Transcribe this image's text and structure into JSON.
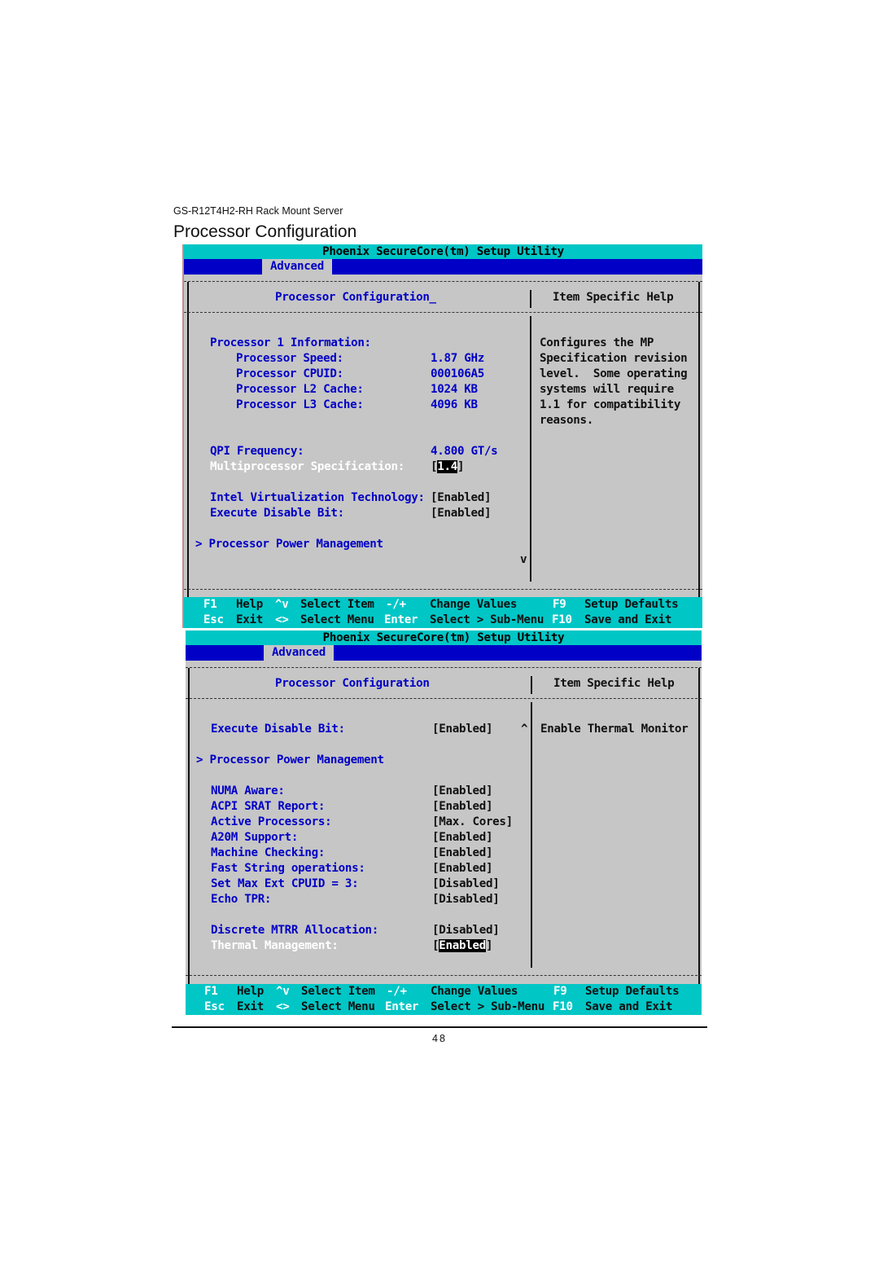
{
  "document": {
    "header": "GS-R12T4H2-RH Rack Mount Server",
    "section_title": "Processor Configuration",
    "page_number": "48"
  },
  "screens": [
    {
      "title": "Phoenix SecureCore(tm) Setup Utility",
      "active_menu": "Advanced",
      "panel_title": "Processor Configuration_",
      "help_title": "Item Specific Help",
      "items": [
        {
          "label": "Processor 1 Information:",
          "value": "",
          "indent": 0,
          "style": "blue"
        },
        {
          "label": "Processor Speed:",
          "value": "1.87 GHz",
          "indent": 1,
          "style": "blue"
        },
        {
          "label": "Processor CPUID:",
          "value": "000106A5",
          "indent": 1,
          "style": "blue"
        },
        {
          "label": "Processor L2 Cache:",
          "value": "1024 KB",
          "indent": 1,
          "style": "blue"
        },
        {
          "label": "Processor L3 Cache:",
          "value": "4096 KB",
          "indent": 1,
          "style": "blue"
        },
        {
          "label": "QPI Frequency:",
          "value": "4.800 GT/s",
          "indent": 0,
          "style": "blue"
        },
        {
          "label": "Multiprocessor Specification:",
          "value": "1.4",
          "indent": 0,
          "style": "selected"
        },
        {
          "label": "Intel Virtualization Technology:",
          "value": "Enabled",
          "indent": 0,
          "style": "option"
        },
        {
          "label": "Execute Disable Bit:",
          "value": "Enabled",
          "indent": 0,
          "style": "option"
        },
        {
          "label": "Processor Power Management",
          "value": "",
          "indent": 0,
          "style": "submenu",
          "marker": ">"
        }
      ],
      "help_text": [
        "Configures the MP",
        "Specification revision",
        "level.  Some operating",
        "systems will require",
        "1.1 for compatibility",
        "reasons."
      ],
      "scroll_indicator": "v"
    },
    {
      "title": "Phoenix SecureCore(tm) Setup Utility",
      "active_menu": "Advanced",
      "panel_title": "Processor Configuration",
      "help_title": "Item Specific Help",
      "items": [
        {
          "label": "Execute Disable Bit:",
          "value": "Enabled",
          "style": "option"
        },
        {
          "label": "Processor Power Management",
          "value": "",
          "style": "submenu",
          "marker": ">"
        },
        {
          "label": "NUMA Aware:",
          "value": "Enabled",
          "style": "option"
        },
        {
          "label": "ACPI SRAT Report:",
          "value": "Enabled",
          "style": "option"
        },
        {
          "label": "Active Processors:",
          "value": "Max. Cores",
          "style": "option"
        },
        {
          "label": "A20M Support:",
          "value": "Enabled",
          "style": "option"
        },
        {
          "label": "Machine Checking:",
          "value": "Enabled",
          "style": "option"
        },
        {
          "label": "Fast String operations:",
          "value": "Enabled",
          "style": "option"
        },
        {
          "label": "Set Max Ext CPUID = 3:",
          "value": "Disabled",
          "style": "option"
        },
        {
          "label": "Echo TPR:",
          "value": "Disabled",
          "style": "option"
        },
        {
          "label": "Discrete MTRR Allocation:",
          "value": "Disabled",
          "style": "option"
        },
        {
          "label": "Thermal Management:",
          "value": "Enabled",
          "style": "selected"
        }
      ],
      "help_text": [
        "Enable Thermal Monitor"
      ],
      "scroll_indicator": "^"
    }
  ],
  "footer_keys": {
    "row1": [
      {
        "key": "F1",
        "label": "Help"
      },
      {
        "key": "^v",
        "label": "Select Item"
      },
      {
        "key": "-/+",
        "label": "Change Values"
      },
      {
        "key": "F9",
        "label": "Setup Defaults"
      }
    ],
    "row2": [
      {
        "key": "Esc",
        "label": "Exit"
      },
      {
        "key": "<>",
        "label": "Select Menu"
      },
      {
        "key": "Enter",
        "label": "Select > Sub-Menu"
      },
      {
        "key": "F10",
        "label": "Save and Exit"
      }
    ]
  },
  "colors": {
    "title_bar": "#00c6c6",
    "menu_bar": "#0000c6",
    "panel_bg": "#c6c6c6",
    "item_text": "#0000c6",
    "selected_text": "#ffffff"
  }
}
